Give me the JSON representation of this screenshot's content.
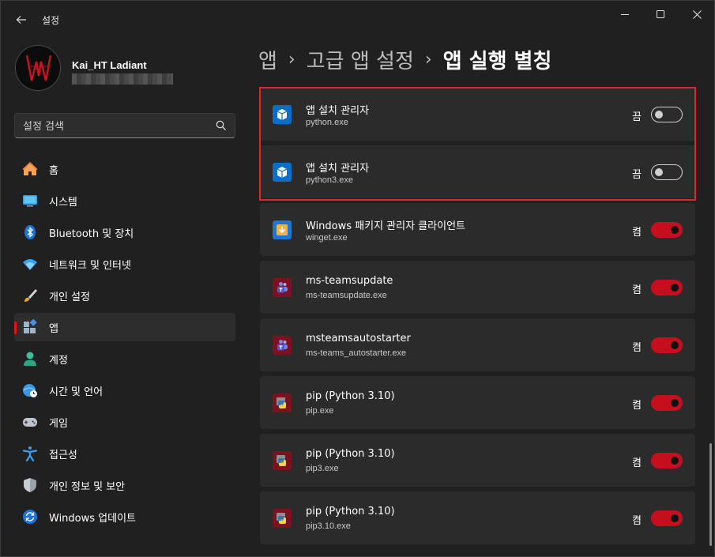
{
  "titlebar": {
    "back_icon": "back-arrow-icon",
    "title": "설정"
  },
  "profile": {
    "name": "Kai_HT Ladiant"
  },
  "search": {
    "placeholder": "설정 검색",
    "icon": "search-icon"
  },
  "nav": {
    "items": [
      {
        "label": "홈",
        "icon": "home-icon"
      },
      {
        "label": "시스템",
        "icon": "system-icon"
      },
      {
        "label": "Bluetooth 및 장치",
        "icon": "bluetooth-icon"
      },
      {
        "label": "네트워크 및 인터넷",
        "icon": "wifi-icon"
      },
      {
        "label": "개인 설정",
        "icon": "brush-icon"
      },
      {
        "label": "앱",
        "icon": "apps-icon",
        "active": true
      },
      {
        "label": "계정",
        "icon": "account-icon"
      },
      {
        "label": "시간 및 언어",
        "icon": "time-language-icon"
      },
      {
        "label": "게임",
        "icon": "gamepad-icon"
      },
      {
        "label": "접근성",
        "icon": "accessibility-icon"
      },
      {
        "label": "개인 정보 및 보안",
        "icon": "shield-icon"
      },
      {
        "label": "Windows 업데이트",
        "icon": "update-icon"
      }
    ]
  },
  "breadcrumb": {
    "part1": "앱",
    "part2": "고급 앱 설정",
    "current": "앱 실행 별칭",
    "separator": "›"
  },
  "aliases": [
    {
      "title": "앱 설치 관리자",
      "exe": "python.exe",
      "state": "끔",
      "on": false,
      "icon": "app-installer-icon"
    },
    {
      "title": "앱 설치 관리자",
      "exe": "python3.exe",
      "state": "끔",
      "on": false,
      "icon": "app-installer-icon"
    },
    {
      "title": "Windows 패키지 관리자 클라이언트",
      "exe": "winget.exe",
      "state": "켬",
      "on": true,
      "icon": "winget-icon"
    },
    {
      "title": "ms-teamsupdate",
      "exe": "ms-teamsupdate.exe",
      "state": "켬",
      "on": true,
      "icon": "teams-icon"
    },
    {
      "title": "msteamsautostarter",
      "exe": "ms-teams_autostarter.exe",
      "state": "켬",
      "on": true,
      "icon": "teams-icon"
    },
    {
      "title": "pip (Python 3.10)",
      "exe": "pip.exe",
      "state": "켬",
      "on": true,
      "icon": "python-icon"
    },
    {
      "title": "pip (Python 3.10)",
      "exe": "pip3.exe",
      "state": "켬",
      "on": true,
      "icon": "python-icon"
    },
    {
      "title": "pip (Python 3.10)",
      "exe": "pip3.10.exe",
      "state": "켬",
      "on": true,
      "icon": "python-icon"
    }
  ],
  "colors": {
    "accent": "#c50f1f",
    "highlight": "#e0262b",
    "background": "#202020",
    "card": "#2b2b2b"
  }
}
